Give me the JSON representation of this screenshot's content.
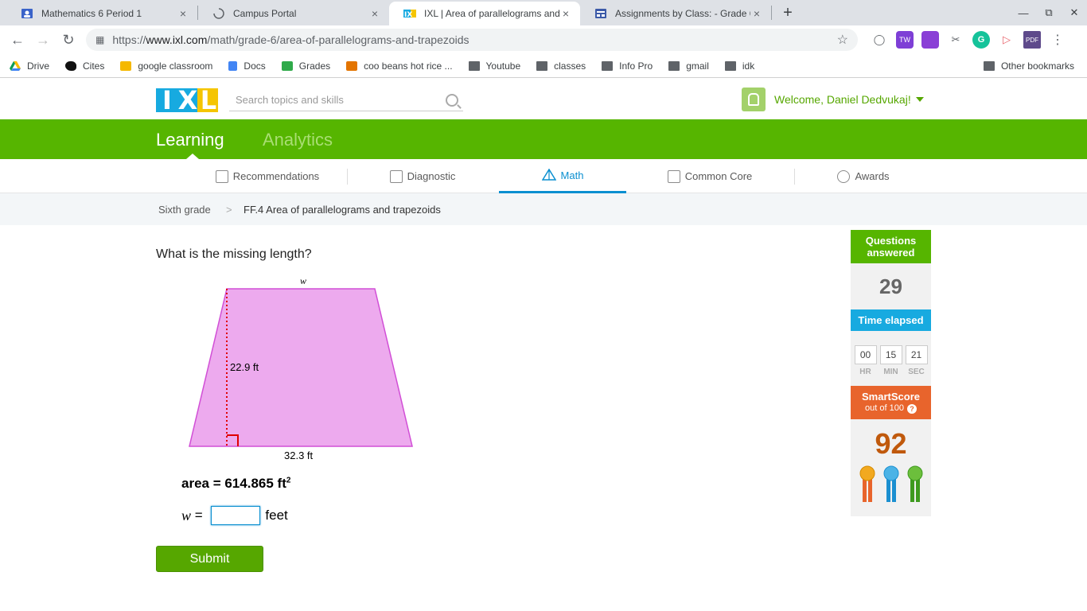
{
  "browser": {
    "tabs": [
      {
        "title": "Mathematics 6 Period 1",
        "icon": "google-classroom-icon",
        "active": false
      },
      {
        "title": "Campus Portal",
        "icon": "loading-spinner-icon",
        "active": false
      },
      {
        "title": "IXL | Area of parallelograms and",
        "icon": "ixl-icon",
        "active": true
      },
      {
        "title": "Assignments by Class: - Grade 6",
        "icon": "assignments-icon",
        "active": false
      }
    ],
    "close_glyph": "×",
    "new_tab_glyph": "+",
    "url_prefix": "https://",
    "url_host": "www.ixl.com",
    "url_path": "/math/grade-6/area-of-parallelograms-and-trapezoids",
    "bookmarks": [
      {
        "label": "Drive",
        "icon": "drive-icon"
      },
      {
        "label": "Cites",
        "icon": "cites-icon"
      },
      {
        "label": "google classroom",
        "icon": "classroom-icon"
      },
      {
        "label": "Docs",
        "icon": "docs-icon"
      },
      {
        "label": "Grades",
        "icon": "grades-icon"
      },
      {
        "label": "coo beans hot rice ...",
        "icon": "classroom-icon"
      },
      {
        "label": "Youtube",
        "icon": "folder-icon"
      },
      {
        "label": "classes",
        "icon": "folder-icon"
      },
      {
        "label": "Info Pro",
        "icon": "folder-icon"
      },
      {
        "label": "gmail",
        "icon": "folder-icon"
      },
      {
        "label": "idk",
        "icon": "folder-icon"
      }
    ],
    "other_bookmarks": "Other bookmarks"
  },
  "header": {
    "logo": [
      "I",
      "X",
      "L"
    ],
    "search_placeholder": "Search topics and skills",
    "welcome": "Welcome, Daniel Dedvukaj!"
  },
  "main_nav": {
    "learning": "Learning",
    "analytics": "Analytics"
  },
  "sub_nav": [
    {
      "label": "Recommendations",
      "icon": "recommendations-icon"
    },
    {
      "label": "Diagnostic",
      "icon": "diagnostic-icon"
    },
    {
      "label": "Math",
      "icon": "math-pyramid-icon",
      "active": true
    },
    {
      "label": "Common Core",
      "icon": "common-core-icon"
    },
    {
      "label": "Awards",
      "icon": "awards-icon"
    }
  ],
  "breadcrumb": {
    "grade": "Sixth grade",
    "separator": ">",
    "skill": "FF.4 Area of parallelograms and trapezoids"
  },
  "problem": {
    "question": "What is the missing length?",
    "figure": {
      "top_label": "w",
      "height_label": "22.9 ft",
      "base_label": "32.3 ft",
      "fill": "#edaaee",
      "stroke": "#d14fd6",
      "height_line_color": "#e00000"
    },
    "area_prefix": "area = 614.865 ft",
    "area_exponent": "2",
    "answer_var": "w",
    "answer_eq": " = ",
    "answer_value": "",
    "answer_unit": "feet",
    "submit": "Submit"
  },
  "sidebar": {
    "questions_header": "Questions answered",
    "questions_count": "29",
    "time_header": "Time elapsed",
    "time": {
      "hr": "00",
      "min": "15",
      "sec": "21"
    },
    "time_labels": {
      "hr": "HR",
      "min": "MIN",
      "sec": "SEC"
    },
    "smartscore_header": "SmartScore",
    "smartscore_sub": "out of 100",
    "smartscore_help": "?",
    "smartscore": "92",
    "ribbons": [
      {
        "name": "gold-ribbon-icon",
        "color": "#f2a91f",
        "tail": "#e8642c"
      },
      {
        "name": "blue-ribbon-icon",
        "color": "#4bb3e6",
        "tail": "#1b8fd0"
      },
      {
        "name": "green-ribbon-icon",
        "color": "#6cbf3c",
        "tail": "#3e9a1f"
      }
    ]
  }
}
